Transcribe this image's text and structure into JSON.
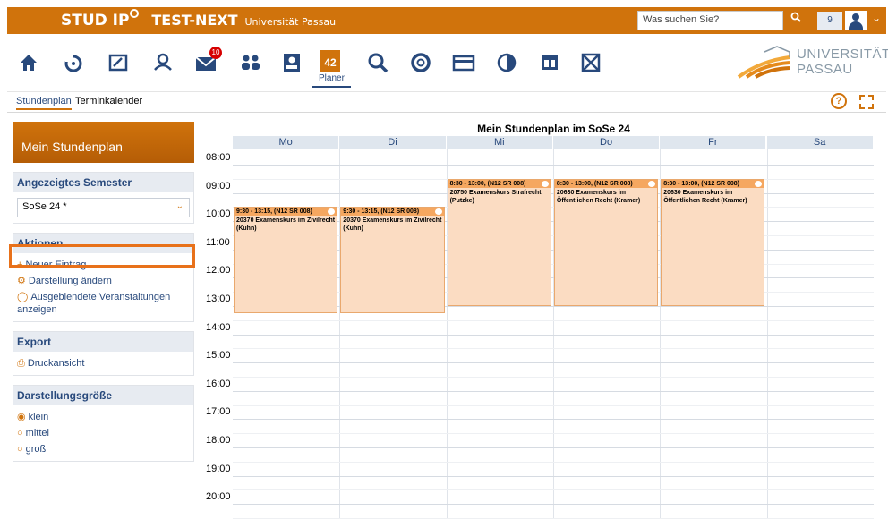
{
  "header": {
    "brand": "STUD IP",
    "environment": "TEST-NEXT",
    "university": "Universität Passau",
    "search_placeholder": "Was suchen Sie?",
    "notification_count": "9"
  },
  "nav": {
    "icons": [
      "home-icon",
      "activity-icon",
      "courses-icon",
      "community-icon",
      "mail-icon",
      "contacts-icon",
      "profile-icon",
      "planer-icon",
      "search-icon",
      "help-icon",
      "card-icon",
      "chart-icon",
      "split-icon",
      "disabled-icon"
    ],
    "mail_badge": "10",
    "planer_label": "Planer",
    "planer_date": "42",
    "uni_logo_line1": "UNIVERSITÄT",
    "uni_logo_line2": "PASSAU"
  },
  "subnav": {
    "items": [
      "Stundenplan",
      "Terminkalender"
    ]
  },
  "sidebar": {
    "title": "Mein Stundenplan",
    "semester_head": "Angezeigtes Semester",
    "semester_value": "SoSe 24 *",
    "actions_head": "Aktionen",
    "actions": [
      "Neuer Eintrag",
      "Darstellung ändern",
      "Ausgeblendete Veranstaltungen anzeigen"
    ],
    "export_head": "Export",
    "export_items": [
      "Druckansicht"
    ],
    "size_head": "Darstellungsgröße",
    "size_options": [
      "klein",
      "mittel",
      "groß"
    ],
    "size_selected": "klein"
  },
  "calendar": {
    "title": "Mein Stundenplan im SoSe 24",
    "days": [
      "Mo",
      "Di",
      "Mi",
      "Do",
      "Fr",
      "Sa"
    ],
    "hours": [
      "08:00",
      "09:00",
      "10:00",
      "11:00",
      "12:00",
      "13:00",
      "14:00",
      "15:00",
      "16:00",
      "17:00",
      "18:00",
      "19:00",
      "20:00"
    ],
    "events": [
      {
        "day": 0,
        "start": 9.5,
        "end": 13.25,
        "time": "9:30 - 13:15, (N12 SR 008)",
        "title": "20370 Examenskurs im Zivilrecht (Kuhn)"
      },
      {
        "day": 1,
        "start": 9.5,
        "end": 13.25,
        "time": "9:30 - 13:15, (N12 SR 008)",
        "title": "20370 Examenskurs im Zivilrecht (Kuhn)"
      },
      {
        "day": 2,
        "start": 8.5,
        "end": 13.0,
        "time": "8:30 - 13:00, (N12 SR 008)",
        "title": "20750 Examenskurs Strafrecht (Putzke)"
      },
      {
        "day": 3,
        "start": 8.5,
        "end": 13.0,
        "time": "8:30 - 13:00, (N12 SR 008)",
        "title": "20630 Examenskurs im Öffentlichen Recht (Kramer)"
      },
      {
        "day": 4,
        "start": 8.5,
        "end": 13.0,
        "time": "8:30 - 13:00, (N12 SR 008)",
        "title": "20630 Examenskurs im Öffentlichen Recht (Kramer)"
      }
    ]
  },
  "colors": {
    "accent": "#d0730c",
    "brand_blue": "#28497c",
    "event_bg": "#fbdcc2",
    "highlight": "#e8711a"
  }
}
